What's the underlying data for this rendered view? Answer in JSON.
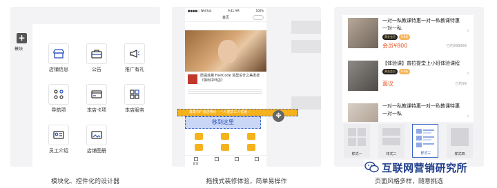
{
  "panel1": {
    "sidebar_label": "模块",
    "add_symbol": "+",
    "modules": [
      {
        "label": "店铺信息",
        "icon": "store-icon"
      },
      {
        "label": "公告",
        "icon": "briefcase-icon"
      },
      {
        "label": "推广有礼",
        "icon": "megaphone-icon"
      },
      {
        "label": "导航项",
        "icon": "grid-dots-icon"
      },
      {
        "label": "本店卡项",
        "icon": "card-icon"
      },
      {
        "label": "本店服务",
        "icon": "grid-squares-icon"
      },
      {
        "label": "员工介绍",
        "icon": "id-card-icon"
      },
      {
        "label": "店铺图册",
        "icon": "image-icon"
      }
    ],
    "caption": "模块化、控件化的设计器"
  },
  "panel2": {
    "status_left": "●●●●○ WeChat",
    "status_time": "9:41 AM",
    "status_right": "100%",
    "page_title": "首页",
    "article_title": "愿提丝黛 HairCode 造型设计之美发技《保利中环店》",
    "banner_text": "尊享VIP 创店特价 · 一人重享三人优惠 ›",
    "drop_label": "移到这里",
    "move_symbol": "✥",
    "tabs": [
      "首页",
      "",
      "",
      ""
    ],
    "caption": "拖拽式装修体验，简单易操作"
  },
  "panel3": {
    "products": [
      {
        "title": "一对一私教课特惠一对一私教课特惠一对一私",
        "badge_a": "黄金会员",
        "badge_b": "6.8折",
        "price": "会员¥800",
        "price_sub": "¥98.00",
        "sold": "已约999999"
      },
      {
        "title": "【体验课】普拉提堂上小班体验课程",
        "badge_a": "黄金会员",
        "badge_b": "6.8折",
        "price": "面议",
        "price_sub": "",
        "sold": "已约99"
      },
      {
        "title": "一对一私教课特惠一对一私教课特惠一对一私",
        "badge_a": "",
        "badge_b": "",
        "price": "",
        "price_sub": "",
        "sold": ""
      }
    ],
    "styles": [
      "样式一",
      "样式二",
      "样式三",
      "样式四"
    ],
    "selected_style": 2,
    "caption": "页面风格多样，随意挑选"
  },
  "brand": {
    "text": "互联网营销研究所",
    "icon": "wechat-logo-icon"
  },
  "colors": {
    "accent": "#3b66c7",
    "orange": "#f5b21d",
    "price": "#e8511f",
    "brand": "#1f3e8a"
  }
}
